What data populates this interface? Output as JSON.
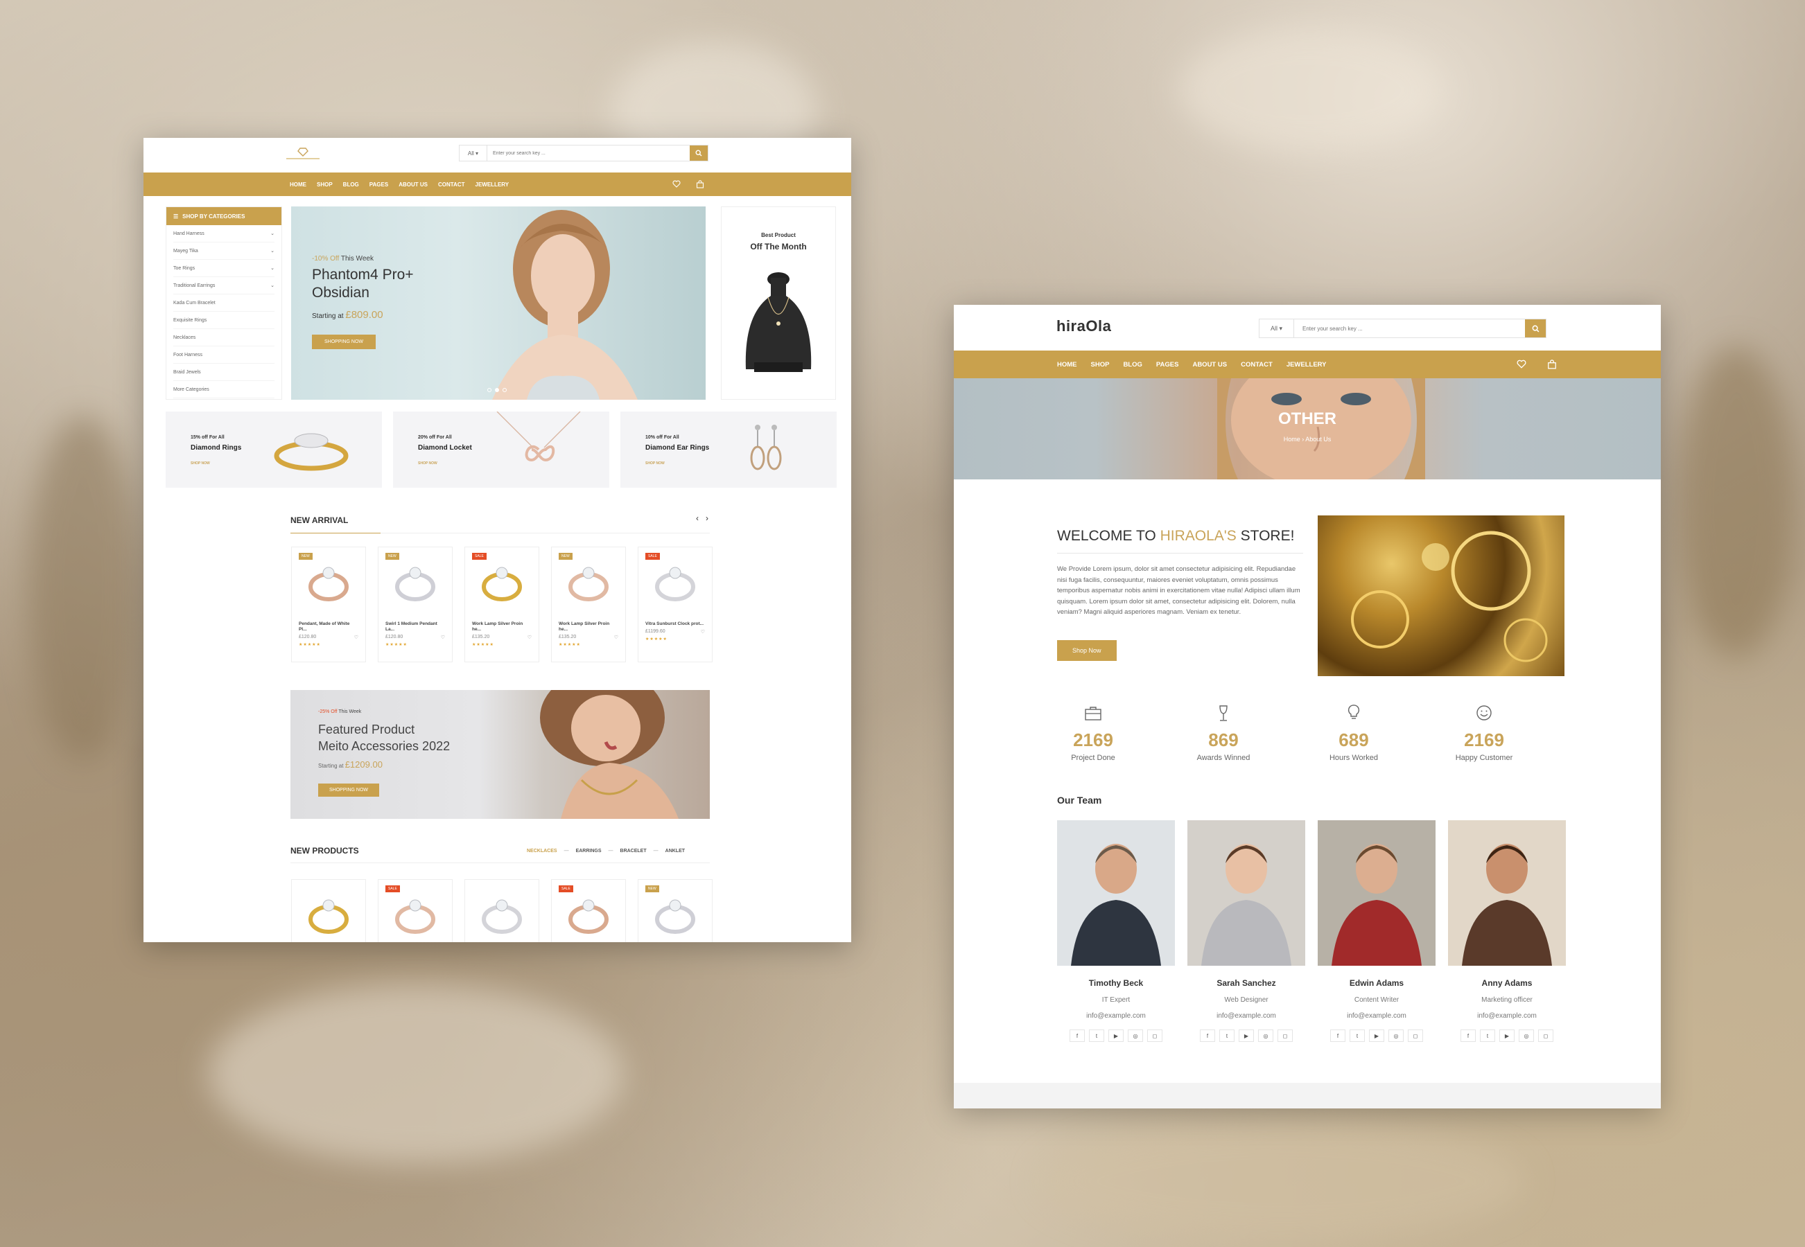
{
  "theme": {
    "gold": "#c9a14d",
    "sale": "#e44d26",
    "new": "#c9a14d"
  },
  "home": {
    "search": {
      "category": "All",
      "placeholder": "Enter your search key ..."
    },
    "nav": [
      "HOME",
      "SHOP",
      "BLOG",
      "PAGES",
      "ABOUT US",
      "CONTACT",
      "JEWELLERY"
    ],
    "categories_title": "SHOP BY CATEGORIES",
    "categories": [
      "Hand Harness",
      "Mayeg Tika",
      "Toe Rings",
      "Traditional Earrings",
      "Kada Cum Bracelet",
      "Exquisite Rings",
      "Necklaces",
      "Foot Harness",
      "Braid Jewels",
      "More Categories"
    ],
    "hero": {
      "discount": "-10% Off",
      "week": "This Week",
      "title": "Phantom4 Pro+ Obsidian",
      "starting": "Starting at",
      "price": "£809.00",
      "button": "SHOPPING NOW"
    },
    "best": {
      "label": "Best Product",
      "title": "Off The Month"
    },
    "promos": [
      {
        "line1": "15% off For All",
        "line2": "Diamond Rings",
        "link": "SHOP NOW"
      },
      {
        "line1": "20% off For All",
        "line2": "Diamond Locket",
        "link": "SHOP NOW"
      },
      {
        "line1": "10% off For All",
        "line2": "Diamond Ear Rings",
        "link": "SHOP NOW"
      }
    ],
    "new_arrival": "NEW ARRIVAL",
    "arrivals": [
      {
        "badge": "NEW",
        "badge_type": "new",
        "name": "Pendant, Made of White Pl...",
        "price": "£120.80",
        "stars": "★★★★★"
      },
      {
        "badge": "NEW",
        "badge_type": "new",
        "name": "Swirl 1 Medium Pendant La...",
        "price": "£120.80",
        "stars": "★★★★★"
      },
      {
        "badge": "SALE",
        "badge_type": "sale",
        "name": "Work Lamp Silver Proin he...",
        "price": "£135.20",
        "stars": "★★★★★"
      },
      {
        "badge": "NEW",
        "badge_type": "new",
        "name": "Work Lamp Silver Proin he...",
        "price": "£135.20",
        "stars": "★★★★★"
      },
      {
        "badge": "SALE",
        "badge_type": "sale",
        "name": "Vitra Sunburst Clock prot...",
        "price": "£1199.60",
        "stars": "★★★★★"
      }
    ],
    "featured": {
      "discount": "-25% Off",
      "week": "This Week",
      "line1": "Featured Product",
      "line2": "Meito Accessories 2022",
      "starting": "Starting at",
      "price": "£1209.00",
      "button": "SHOPPING NOW"
    },
    "new_products": "NEW PRODUCTS",
    "tabs": [
      "NECKLACES",
      "EARRINGS",
      "BRACELET",
      "ANKLET"
    ],
    "products": [
      {
        "badge": ""
      },
      {
        "badge": "SALE"
      },
      {
        "badge": ""
      },
      {
        "badge": "SALE"
      },
      {
        "badge": "NEW"
      }
    ]
  },
  "about": {
    "logo": "hiraOla",
    "search": {
      "category": "All",
      "placeholder": "Enter your search key ..."
    },
    "nav": [
      "HOME",
      "SHOP",
      "BLOG",
      "PAGES",
      "ABOUT US",
      "CONTACT",
      "JEWELLERY"
    ],
    "banner": {
      "title": "OTHER",
      "crumb_home": "Home",
      "crumb_sep": "›",
      "crumb_current": "About Us"
    },
    "welcome": {
      "pre": "WELCOME TO ",
      "brand": "HIRAOLA'S",
      "post": " STORE!"
    },
    "text": "We Provide Lorem ipsum, dolor sit amet consectetur adipisicing elit. Repudiandae nisi fuga facilis, consequuntur, maiores eveniet voluptatum, omnis possimus temporibus aspernatur nobis animi in exercitationem vitae nulla! Adipisci ullam illum quisquam. Lorem ipsum dolor sit amet, consectetur adipisicing elit. Dolorem, nulla veniam? Magni aliquid asperiores magnam. Veniam ex tenetur.",
    "button": "Shop Now",
    "stats": [
      {
        "icon": "briefcase-icon",
        "value": "2169",
        "label": "Project Done"
      },
      {
        "icon": "glass-icon",
        "value": "869",
        "label": "Awards Winned"
      },
      {
        "icon": "bulb-icon",
        "value": "689",
        "label": "Hours Worked"
      },
      {
        "icon": "smile-icon",
        "value": "2169",
        "label": "Happy Customer"
      }
    ],
    "team_title": "Our Team",
    "team": [
      {
        "name": "Timothy Beck",
        "role": "IT Expert",
        "email": "info@example.com"
      },
      {
        "name": "Sarah Sanchez",
        "role": "Web Designer",
        "email": "info@example.com"
      },
      {
        "name": "Edwin Adams",
        "role": "Content Writer",
        "email": "info@example.com"
      },
      {
        "name": "Anny Adams",
        "role": "Marketing officer",
        "email": "info@example.com"
      }
    ]
  }
}
